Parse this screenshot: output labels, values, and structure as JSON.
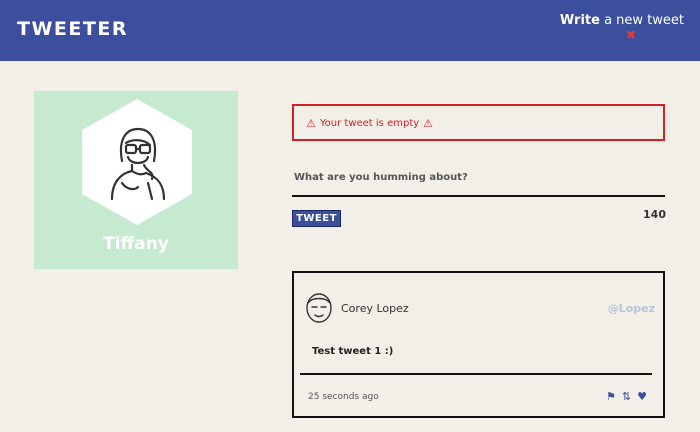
{
  "header": {
    "logo": "TWEETER",
    "compose_bold": "Write",
    "compose_rest": " a new tweet"
  },
  "profile": {
    "name": "Tiffany",
    "card_color": "#c6ead0"
  },
  "composer": {
    "error": "Your tweet is empty",
    "placeholder": "What are you humming about?",
    "button_label": "TWEET",
    "char_count": "140"
  },
  "tweets": [
    {
      "author": "Corey Lopez",
      "handle": "@Lopez",
      "body": "Test tweet 1 :)",
      "time": "25 seconds ago",
      "actions": [
        "flag-icon",
        "retweet-icon",
        "heart-icon"
      ]
    }
  ],
  "colors": {
    "brand": "#3b4f9c",
    "error": "#d32027",
    "background": "#f2efe9"
  }
}
